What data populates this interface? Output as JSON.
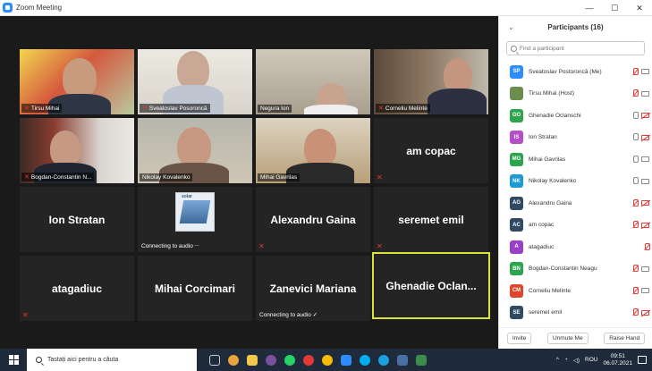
{
  "window": {
    "title": "Zoom Meeting",
    "minimize": "—",
    "maximize": "☐",
    "close": "✕"
  },
  "tiles": [
    {
      "name": "Tirsu Mihai",
      "type": "video"
    },
    {
      "name": "Sveatoslav Posoroncă",
      "type": "video"
    },
    {
      "name": "Negura Ion",
      "type": "video"
    },
    {
      "name": "Corneliu Melinte",
      "type": "video"
    },
    {
      "name": "Bogdan-Constantin N...",
      "type": "video"
    },
    {
      "name": "Nikolay Kovalenko",
      "type": "video"
    },
    {
      "name": "Mihai Gavrilas",
      "type": "video"
    },
    {
      "name": "am copac",
      "type": "name"
    },
    {
      "name": "Ion Stratan",
      "type": "name"
    },
    {
      "name": "Connecting to audio ᐧᐧᐧ",
      "type": "connecting"
    },
    {
      "name": "Alexandru Gaina",
      "type": "name"
    },
    {
      "name": "seremet emil",
      "type": "name"
    },
    {
      "name": "atagadiuc",
      "type": "name"
    },
    {
      "name": "Mihai Corcimari",
      "type": "name"
    },
    {
      "name": "Zanevici Mariana",
      "type": "name",
      "audio": "Connecting to audio ✓"
    },
    {
      "name": "Ghenadie Oclan...",
      "type": "name"
    }
  ],
  "solar_text": "solar",
  "panel": {
    "title": "Participants (16)",
    "search_placeholder": "Find a participant",
    "participants": [
      {
        "initials": "SP",
        "name": "Sveatoslav Postoroncă (Me)",
        "color": "#2d8cff"
      },
      {
        "initials": "",
        "name": "Tirsu Mihai (Host)",
        "color": "#6b8e4e"
      },
      {
        "initials": "GO",
        "name": "Ghenadie Oclanschi",
        "color": "#2ea44f"
      },
      {
        "initials": "IS",
        "name": "Ion Stratan",
        "color": "#b44fc7"
      },
      {
        "initials": "MG",
        "name": "Mihai Gavrilas",
        "color": "#2ea44f"
      },
      {
        "initials": "NK",
        "name": "Nikolay Kovalenko",
        "color": "#1e9bd7"
      },
      {
        "initials": "AG",
        "name": "Alexandru Gaina",
        "color": "#2f4a62"
      },
      {
        "initials": "AC",
        "name": "am copac",
        "color": "#2f4a62"
      },
      {
        "initials": "A",
        "name": "atagadiuc",
        "color": "#9b3fc6"
      },
      {
        "initials": "BN",
        "name": "Bogdan-Constantin Neagu",
        "color": "#2ea44f"
      },
      {
        "initials": "CM",
        "name": "Corneliu Melinte",
        "color": "#e0452c"
      },
      {
        "initials": "SE",
        "name": "seremet emil",
        "color": "#2f4a62"
      }
    ],
    "invite": "Invite",
    "unmute": "Unmute Me",
    "raise": "Raise Hand"
  },
  "taskbar": {
    "search_text": "Tastați aici pentru a căuta",
    "lang": "ROU",
    "time": "09:51",
    "date": "06.07.2021"
  }
}
